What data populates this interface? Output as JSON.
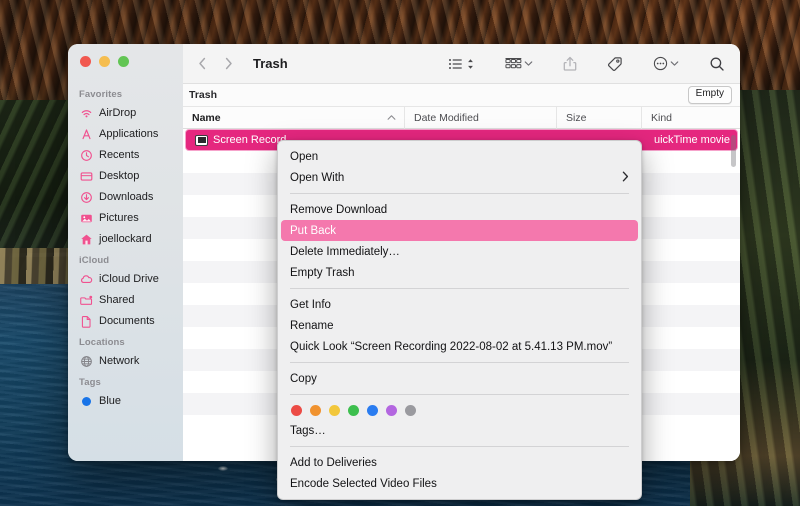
{
  "window": {
    "title": "Trash",
    "traffic_lights": [
      "close",
      "minimize",
      "maximize"
    ]
  },
  "toolbar": {
    "back_icon": "chevron-left-icon",
    "forward_icon": "chevron-right-icon",
    "view_list_icon": "list-view-icon",
    "view_sort_icon": "sort-chevrons-icon",
    "group_icon": "group-by-icon",
    "group_chevron": "chevron-down-icon",
    "share_icon": "share-icon",
    "tag_icon": "tag-icon",
    "more_icon": "ellipsis-circle-icon",
    "more_chevron": "chevron-down-icon",
    "search_icon": "search-icon"
  },
  "pathbar": {
    "label": "Trash",
    "empty_button": "Empty"
  },
  "columns": [
    {
      "key": "name",
      "label": "Name",
      "sorted": true,
      "sort_dir": "ascending"
    },
    {
      "key": "date",
      "label": "Date Modified",
      "sorted": false
    },
    {
      "key": "size",
      "label": "Size",
      "sorted": false
    },
    {
      "key": "kind",
      "label": "Kind",
      "sorted": false
    }
  ],
  "files": [
    {
      "name": "Screen Recording 2022-08-02 at 5.41.13 PM.mov",
      "name_visible": "Screen Record",
      "date": "",
      "size": "",
      "kind": "QuickTime movie",
      "kind_visible": "uickTime movie",
      "selected": true,
      "icon": "quicktime-movie-icon"
    }
  ],
  "sidebar": {
    "sections": [
      {
        "header": "Favorites",
        "items": [
          {
            "label": "AirDrop",
            "icon": "airdrop-icon"
          },
          {
            "label": "Applications",
            "icon": "applications-icon"
          },
          {
            "label": "Recents",
            "icon": "recents-clock-icon"
          },
          {
            "label": "Desktop",
            "icon": "desktop-icon"
          },
          {
            "label": "Downloads",
            "icon": "downloads-icon"
          },
          {
            "label": "Pictures",
            "icon": "pictures-icon"
          },
          {
            "label": "joellockard",
            "icon": "home-icon"
          }
        ]
      },
      {
        "header": "iCloud",
        "items": [
          {
            "label": "iCloud Drive",
            "icon": "cloud-icon"
          },
          {
            "label": "Shared",
            "icon": "shared-folder-icon"
          },
          {
            "label": "Documents",
            "icon": "document-icon"
          }
        ]
      },
      {
        "header": "Locations",
        "items": [
          {
            "label": "Network",
            "icon": "network-globe-icon"
          }
        ]
      },
      {
        "header": "Tags",
        "items": [
          {
            "label": "Blue",
            "icon": "blue-tag-dot-icon"
          }
        ]
      }
    ]
  },
  "context_menu": {
    "groups": [
      [
        {
          "label": "Open",
          "submenu": false
        },
        {
          "label": "Open With",
          "submenu": true
        }
      ],
      [
        {
          "label": "Remove Download",
          "highlighted": false
        },
        {
          "label": "Put Back",
          "highlighted": true
        },
        {
          "label": "Delete Immediately…",
          "highlighted": false
        },
        {
          "label": "Empty Trash",
          "highlighted": false
        }
      ],
      [
        {
          "label": "Get Info"
        },
        {
          "label": "Rename"
        },
        {
          "label": "Quick Look “Screen Recording 2022-08-02 at 5.41.13 PM.mov”"
        }
      ],
      [
        {
          "label": "Copy"
        }
      ],
      [
        {
          "label": "Tags…"
        }
      ],
      [
        {
          "label": "Add to Deliveries"
        },
        {
          "label": "Encode Selected Video Files"
        }
      ]
    ],
    "tag_colors": [
      {
        "name": "red",
        "hex": "#ec4b45"
      },
      {
        "name": "orange",
        "hex": "#f0922f"
      },
      {
        "name": "yellow",
        "hex": "#f2c73c"
      },
      {
        "name": "green",
        "hex": "#3dbf4e"
      },
      {
        "name": "blue",
        "hex": "#2a7cf0"
      },
      {
        "name": "purple",
        "hex": "#b366e0"
      },
      {
        "name": "gray",
        "hex": "#9a9a9f"
      }
    ],
    "highlight_color": "#f478ad",
    "submenu_arrow": "chevron-right-icon"
  },
  "colors": {
    "selection_pink": "#e5277f",
    "menu_highlight": "#f478ad",
    "sidebar_icon_pink": "#f0518f",
    "sidebar_bg": "#dfe3e6"
  }
}
